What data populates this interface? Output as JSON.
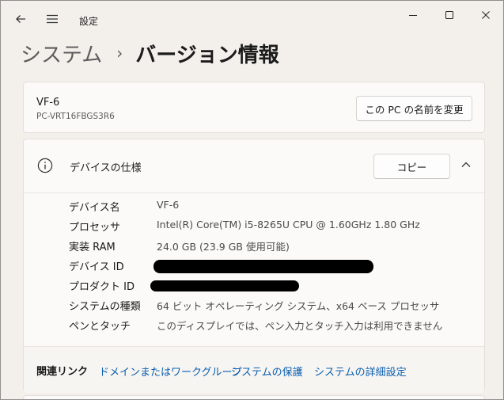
{
  "window": {
    "title": "設定",
    "back_icon": "arrow-left-icon",
    "menu_icon": "hamburger-icon"
  },
  "breadcrumb": {
    "parent": "システム",
    "separator": "›",
    "current": "バージョン情報"
  },
  "pc_card": {
    "name": "VF-6",
    "full_name": "PC-VRT16FBGS3R6",
    "rename_button": "この PC の名前を変更"
  },
  "device_spec": {
    "title": "デバイスの仕様",
    "copy_button": "コピー",
    "rows": [
      {
        "label": "デバイス名",
        "value": "VF-6"
      },
      {
        "label": "プロセッサ",
        "value": "Intel(R) Core(TM) i5-8265U CPU @ 1.60GHz   1.80 GHz"
      },
      {
        "label": "実装 RAM",
        "value": "24.0 GB (23.9 GB 使用可能)"
      },
      {
        "label": "デバイス ID",
        "value": ""
      },
      {
        "label": "プロダクト ID",
        "value": ""
      },
      {
        "label": "システムの種類",
        "value": "64 ビット オペレーティング システム、x64 ベース プロセッサ"
      },
      {
        "label": "ペンとタッチ",
        "value": "このディスプレイでは、ペン入力とタッチ入力は利用できません"
      }
    ]
  },
  "related_links": {
    "label": "関連リンク",
    "links": [
      "ドメインまたはワークグループ",
      "システムの保護",
      "システムの詳細設定"
    ]
  },
  "colors": {
    "background": "#f3f0ec",
    "card": "#fbfaf8",
    "link": "#0b5fb0"
  }
}
